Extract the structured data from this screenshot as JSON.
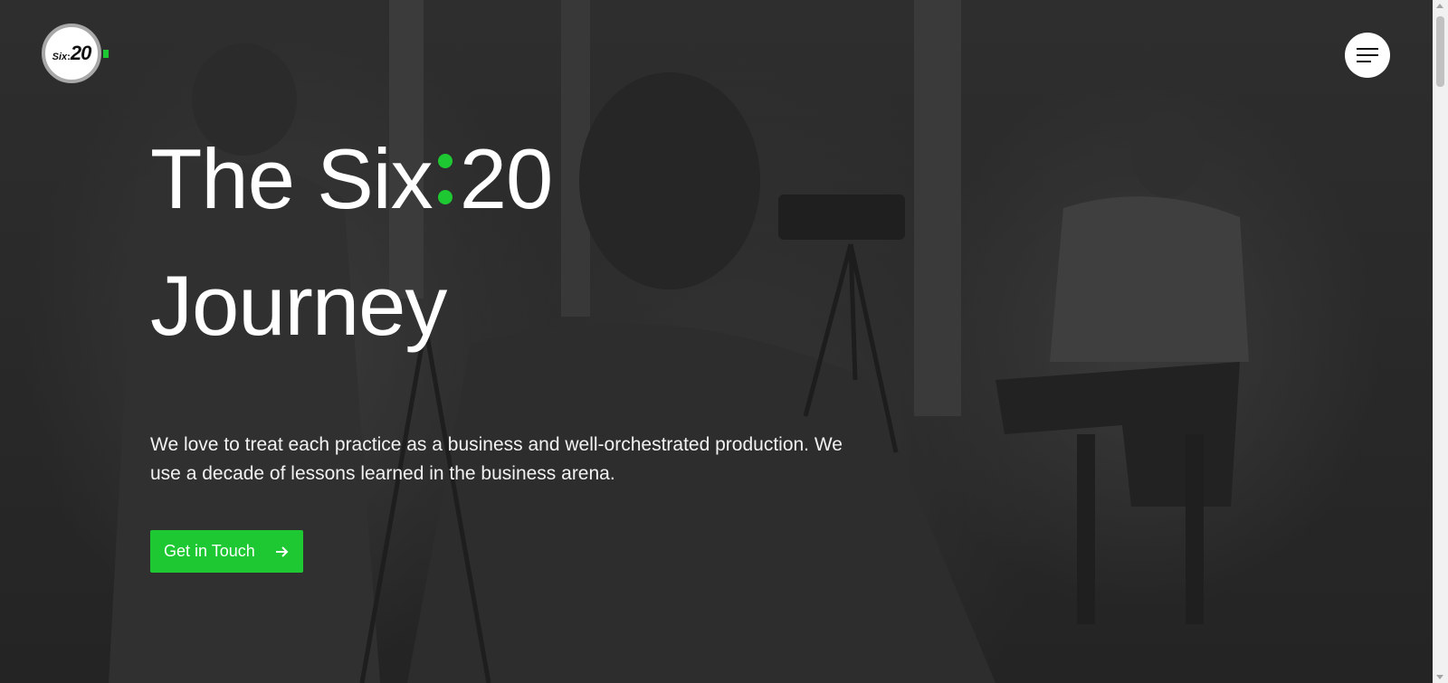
{
  "brand": {
    "logo_six": "Six",
    "logo_colon": ":",
    "logo_number": "20",
    "accent_color": "#1ec832"
  },
  "header": {
    "menu_icon": "hamburger-menu-icon"
  },
  "hero": {
    "title_part1": "The Six",
    "title_part2": "20",
    "title_line2": "Journey",
    "description": "We love to treat each practice as a business and well-orchestrated production. We use a decade of lessons learned in the business arena.",
    "cta_label": "Get in Touch",
    "cta_icon": "arrow-right-icon"
  },
  "colors": {
    "cta_background": "#1ec832",
    "overlay": "#2a2a2a",
    "text": "#ffffff"
  }
}
